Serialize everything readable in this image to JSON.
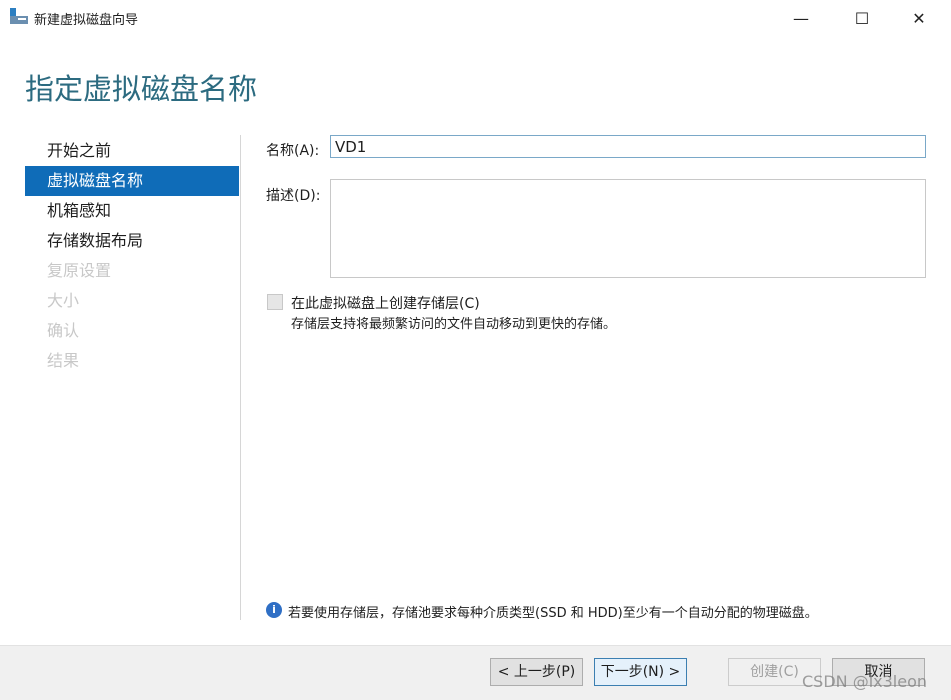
{
  "window": {
    "title": "新建虚拟磁盘向导",
    "minimize": "—",
    "maximize": "☐",
    "close": "✕"
  },
  "page_title": "指定虚拟磁盘名称",
  "nav": [
    {
      "label": "开始之前",
      "state": "normal"
    },
    {
      "label": "虚拟磁盘名称",
      "state": "selected"
    },
    {
      "label": "机箱感知",
      "state": "normal"
    },
    {
      "label": "存储数据布局",
      "state": "normal"
    },
    {
      "label": "复原设置",
      "state": "disabled"
    },
    {
      "label": "大小",
      "state": "disabled"
    },
    {
      "label": "确认",
      "state": "disabled"
    },
    {
      "label": "结果",
      "state": "disabled"
    }
  ],
  "form": {
    "name_label": "名称(A):",
    "name_value": "VD1",
    "desc_label": "描述(D):",
    "desc_value": "",
    "tier_checkbox": "在此虚拟磁盘上创建存储层(C)",
    "tier_hint": "存储层支持将最频繁访问的文件自动移动到更快的存储。"
  },
  "info": "若要使用存储层，存储池要求每种介质类型(SSD 和 HDD)至少有一个自动分配的物理磁盘。",
  "buttons": {
    "prev": "< 上一步(P)",
    "next": "下一步(N) >",
    "create": "创建(C)",
    "cancel": "取消"
  },
  "watermark": "CSDN @lx3leon"
}
